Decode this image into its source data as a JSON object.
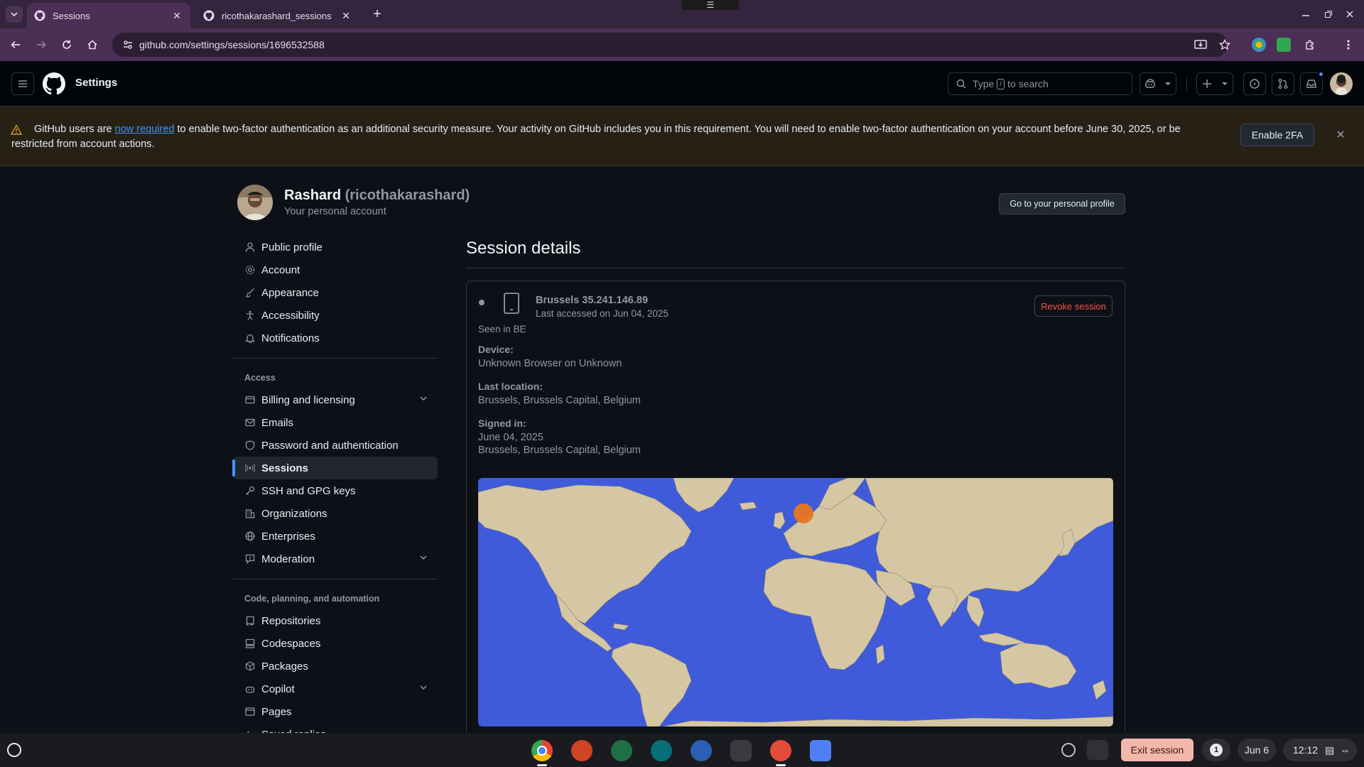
{
  "browser": {
    "tabs": [
      {
        "title": "Sessions",
        "active": true
      },
      {
        "title": "ricothakarashard_sessions",
        "active": false
      }
    ],
    "url": "github.com/settings/sessions/1696532588"
  },
  "header": {
    "title": "Settings",
    "search_placeholder": "to search",
    "search_prefix": "Type",
    "search_key": "/"
  },
  "banner": {
    "text_before": "GitHub users are ",
    "link": "now required",
    "text_after": " to enable two-factor authentication as an additional security measure. Your activity on GitHub includes you in this requirement. You will need to enable two-factor authentication on your account before June 30, 2025, or be restricted from account actions.",
    "button": "Enable 2FA"
  },
  "profile": {
    "name": "Rashard",
    "username": "(ricothakarashard)",
    "subtitle": "Your personal account",
    "profile_button": "Go to your personal profile"
  },
  "sidebar": {
    "items_top": [
      {
        "label": "Public profile",
        "icon": "person-icon"
      },
      {
        "label": "Account",
        "icon": "gear-icon"
      },
      {
        "label": "Appearance",
        "icon": "paintbrush-icon"
      },
      {
        "label": "Accessibility",
        "icon": "accessibility-icon"
      },
      {
        "label": "Notifications",
        "icon": "bell-icon"
      }
    ],
    "access_heading": "Access",
    "items_access": [
      {
        "label": "Billing and licensing",
        "icon": "credit-card-icon",
        "expandable": true
      },
      {
        "label": "Emails",
        "icon": "mail-icon"
      },
      {
        "label": "Password and authentication",
        "icon": "shield-icon"
      },
      {
        "label": "Sessions",
        "icon": "broadcast-icon",
        "selected": true
      },
      {
        "label": "SSH and GPG keys",
        "icon": "key-icon"
      },
      {
        "label": "Organizations",
        "icon": "organization-icon"
      },
      {
        "label": "Enterprises",
        "icon": "globe-icon"
      },
      {
        "label": "Moderation",
        "icon": "report-icon",
        "expandable": true
      }
    ],
    "code_heading": "Code, planning, and automation",
    "items_code": [
      {
        "label": "Repositories",
        "icon": "repo-icon"
      },
      {
        "label": "Codespaces",
        "icon": "codespaces-icon"
      },
      {
        "label": "Packages",
        "icon": "package-icon"
      },
      {
        "label": "Copilot",
        "icon": "copilot-icon",
        "expandable": true
      },
      {
        "label": "Pages",
        "icon": "browser-icon"
      },
      {
        "label": "Saved replies",
        "icon": "reply-icon"
      }
    ]
  },
  "session": {
    "page_title": "Session details",
    "location_ip": "Brussels 35.241.146.89",
    "last_accessed": "Last accessed on Jun 04, 2025",
    "seen_in": "Seen in BE",
    "revoke_button": "Revoke session",
    "device_label": "Device:",
    "device_value": "Unknown Browser on Unknown",
    "last_location_label": "Last location:",
    "last_location_value": "Brussels, Brussels Capital, Belgium",
    "signed_in_label": "Signed in:",
    "signed_in_date": "June 04, 2025",
    "signed_in_location": "Brussels, Brussels Capital, Belgium"
  },
  "taskbar": {
    "exit_session": "Exit session",
    "notification_count": "1",
    "date": "Jun 6",
    "time": "12:12"
  },
  "colors": {
    "ocean": "#3f5bd9",
    "land": "#d6c7a4",
    "marker": "#e87722",
    "accent": "#4493f8"
  }
}
